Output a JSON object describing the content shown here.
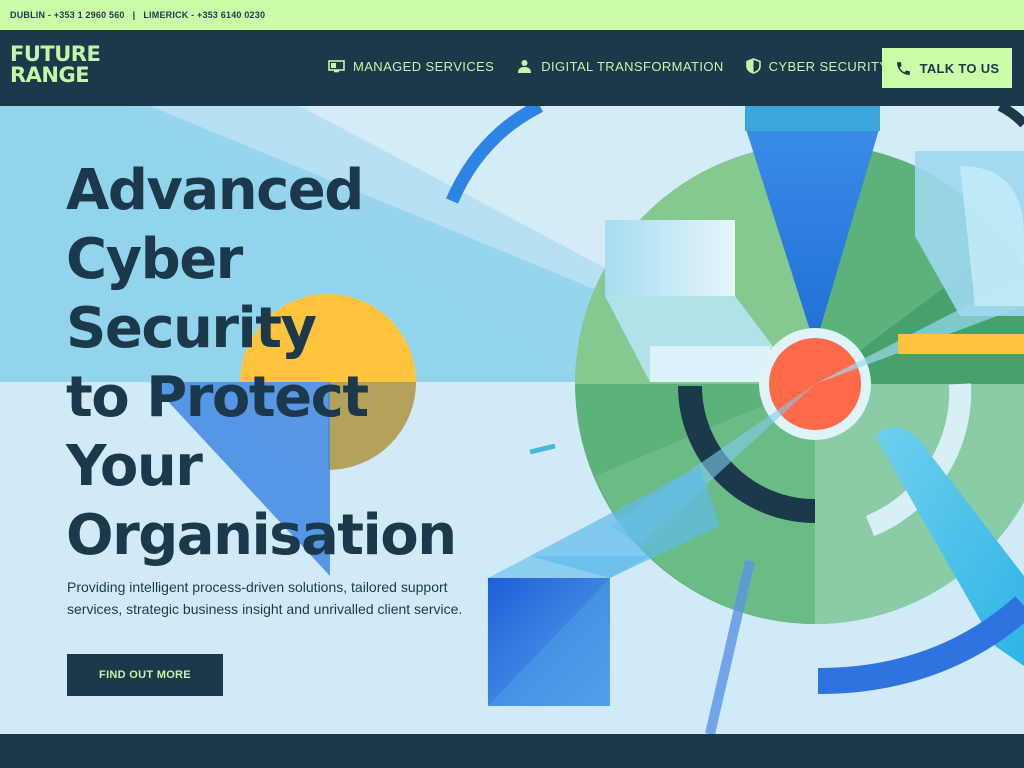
{
  "topbar": {
    "dublin": "DUBLIN - +353 1 2960 560",
    "separator": "|",
    "limerick": "LIMERICK - +353 6140 0230"
  },
  "header": {
    "logo_line1": "FUTURE",
    "logo_line2": "RANGE",
    "nav": [
      {
        "label": "MANAGED SERVICES",
        "icon": "monitor-icon"
      },
      {
        "label": "DIGITAL TRANSFORMATION",
        "icon": "person-icon"
      },
      {
        "label": "CYBER SECURITY",
        "icon": "shield-icon"
      }
    ],
    "cta_label": "TALK TO US",
    "cta_icon": "phone-icon"
  },
  "hero": {
    "title_lines": [
      "Advanced",
      "Cyber",
      "Security",
      "to Protect",
      "Your",
      "Organisation"
    ],
    "subtitle": "Providing intelligent process-driven solutions, tailored support services, strategic business insight and unrivalled client service.",
    "button_label": "FIND OUT MORE"
  },
  "colors": {
    "navy": "#1c394c",
    "lime": "#ccfca8",
    "sky": "#d3ecf7",
    "green": "#5bb37a",
    "blue": "#3a7fe0",
    "orange": "#ff6a4a",
    "yellow": "#ffc43d"
  }
}
